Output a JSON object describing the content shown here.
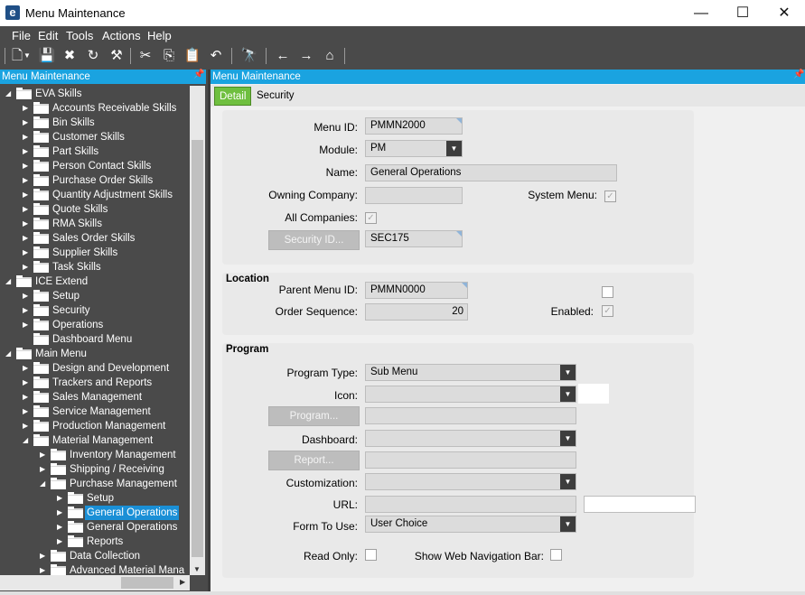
{
  "window": {
    "title": "Menu Maintenance",
    "logo_letter": "e",
    "minimize": "—",
    "maximize": "☐",
    "close": "✕"
  },
  "menubar": {
    "file": "File",
    "edit": "Edit",
    "tools": "Tools",
    "actions": "Actions",
    "help": "Help"
  },
  "left_panel": {
    "title": "Menu Maintenance",
    "tree": [
      {
        "label": "EVA Skills",
        "level": 0,
        "state": "expanded"
      },
      {
        "label": "Accounts Receivable Skills",
        "level": 1,
        "state": "collapsed"
      },
      {
        "label": "Bin Skills",
        "level": 1,
        "state": "collapsed"
      },
      {
        "label": "Customer Skills",
        "level": 1,
        "state": "collapsed"
      },
      {
        "label": "Part Skills",
        "level": 1,
        "state": "collapsed"
      },
      {
        "label": "Person Contact Skills",
        "level": 1,
        "state": "collapsed"
      },
      {
        "label": "Purchase Order Skills",
        "level": 1,
        "state": "collapsed"
      },
      {
        "label": "Quantity Adjustment Skills",
        "level": 1,
        "state": "collapsed"
      },
      {
        "label": "Quote Skills",
        "level": 1,
        "state": "collapsed"
      },
      {
        "label": "RMA Skills",
        "level": 1,
        "state": "collapsed"
      },
      {
        "label": "Sales Order Skills",
        "level": 1,
        "state": "collapsed"
      },
      {
        "label": "Supplier Skills",
        "level": 1,
        "state": "collapsed"
      },
      {
        "label": "Task Skills",
        "level": 1,
        "state": "collapsed"
      },
      {
        "label": "ICE Extend",
        "level": 0,
        "state": "expanded"
      },
      {
        "label": "Setup",
        "level": 1,
        "state": "collapsed"
      },
      {
        "label": "Security",
        "level": 1,
        "state": "collapsed"
      },
      {
        "label": "Operations",
        "level": 1,
        "state": "collapsed"
      },
      {
        "label": "Dashboard Menu",
        "level": 1,
        "state": "none"
      },
      {
        "label": "Main Menu",
        "level": 0,
        "state": "expanded"
      },
      {
        "label": "Design and Development",
        "level": 1,
        "state": "collapsed"
      },
      {
        "label": "Trackers and Reports",
        "level": 1,
        "state": "collapsed"
      },
      {
        "label": "Sales Management",
        "level": 1,
        "state": "collapsed"
      },
      {
        "label": "Service Management",
        "level": 1,
        "state": "collapsed"
      },
      {
        "label": "Production Management",
        "level": 1,
        "state": "collapsed"
      },
      {
        "label": "Material Management",
        "level": 1,
        "state": "expanded"
      },
      {
        "label": "Inventory Management",
        "level": 2,
        "state": "collapsed"
      },
      {
        "label": "Shipping / Receiving",
        "level": 2,
        "state": "collapsed"
      },
      {
        "label": "Purchase Management",
        "level": 2,
        "state": "expanded"
      },
      {
        "label": "Setup",
        "level": 3,
        "state": "collapsed"
      },
      {
        "label": "General Operations",
        "level": 3,
        "state": "collapsed",
        "selected": true
      },
      {
        "label": "General Operations",
        "level": 3,
        "state": "collapsed"
      },
      {
        "label": "Reports",
        "level": 3,
        "state": "collapsed"
      },
      {
        "label": "Data Collection",
        "level": 2,
        "state": "collapsed"
      },
      {
        "label": "Advanced Material Mana",
        "level": 2,
        "state": "collapsed"
      }
    ]
  },
  "right_panel": {
    "title": "Menu Maintenance",
    "tabs": [
      "Detail",
      "Security"
    ],
    "detail": {
      "menu_id_label": "Menu ID:",
      "menu_id": "PMMN2000",
      "module_label": "Module:",
      "module": "PM",
      "name_label": "Name:",
      "name": "General Operations",
      "owning_company_label": "Owning Company:",
      "owning_company": "",
      "system_menu_label": "System Menu:",
      "system_menu_checked": true,
      "all_companies_label": "All Companies:",
      "all_companies_checked": true,
      "security_id_button": "Security ID...",
      "security_id": "SEC175"
    },
    "location": {
      "title": "Location",
      "parent_menu_id_label": "Parent Menu ID:",
      "parent_menu_id": "PMMN0000",
      "order_sequence_label": "Order Sequence:",
      "order_sequence": "20",
      "enabled_label": "Enabled:",
      "enabled_checked": true,
      "unlabeled_checked": false
    },
    "program": {
      "title": "Program",
      "program_type_label": "Program Type:",
      "program_type": "Sub Menu",
      "icon_label": "Icon:",
      "icon": "",
      "program_button": "Program...",
      "program": "",
      "dashboard_label": "Dashboard:",
      "dashboard": "",
      "report_button": "Report...",
      "report": "",
      "customization_label": "Customization:",
      "customization": "",
      "url_label": "URL:",
      "url": "",
      "form_to_use_label": "Form To Use:",
      "form_to_use": "User Choice",
      "read_only_label": "Read Only:",
      "read_only_checked": false,
      "show_web_nav_label": "Show Web Navigation Bar:",
      "show_web_nav_checked": false
    }
  },
  "colors": {
    "accent_blue": "#1aa3e0",
    "tab_green": "#6fbf3f",
    "chrome_dark": "#4a4a4a",
    "selection_blue": "#1a8fd6"
  }
}
